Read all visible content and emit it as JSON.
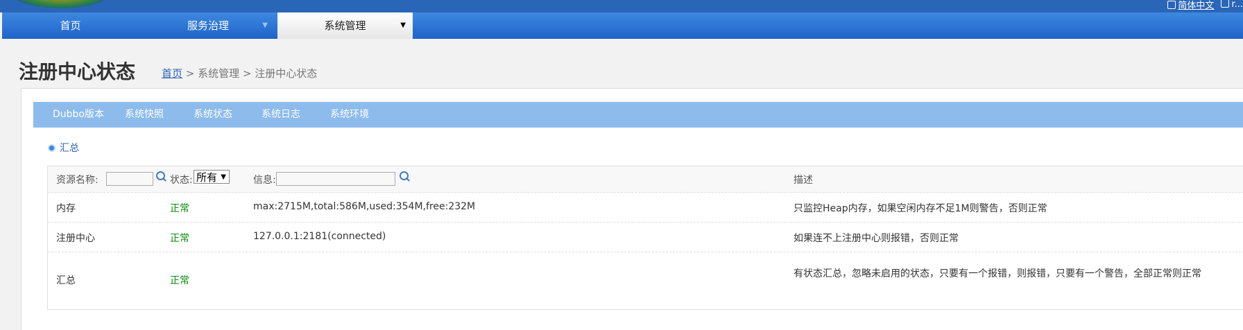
{
  "header": {
    "language_link": "简体中文",
    "user_label": "r..."
  },
  "nav": {
    "home": "首页",
    "service_governance": "服务治理",
    "system_management": "系统管理",
    "dropdown_arrow": "▼"
  },
  "page": {
    "title": "注册中心状态",
    "breadcrumb_home": "首页",
    "breadcrumb_sep1": " > ",
    "breadcrumb_system": "系统管理",
    "breadcrumb_sep2": " > ",
    "breadcrumb_current": "注册中心状态"
  },
  "subtabs": [
    "Dubbo版本",
    "系统快照",
    "系统状态",
    "系统日志",
    "系统环境"
  ],
  "summary_link": "汇总",
  "table": {
    "headers": {
      "name_label": "资源名称:",
      "status_label": "状态:",
      "status_selected": "所有",
      "info_label": "信息:",
      "desc_label": "描述"
    },
    "rows": [
      {
        "name": "内存",
        "status": "正常",
        "info": "max:2715M,total:586M,used:354M,free:232M",
        "desc": "只监控Heap内存，如果空闲内存不足1M则警告，否则正常"
      },
      {
        "name": "注册中心",
        "status": "正常",
        "info": "127.0.0.1:2181(connected)",
        "desc": "如果连不上注册中心则报错，否则正常"
      },
      {
        "name": "汇总",
        "status": "正常",
        "info": "",
        "desc": "有状态汇总，忽略未启用的状态，只要有一个报错，则报错，只要有一个警告，全部正常则正常"
      }
    ]
  },
  "colors": {
    "nav_blue": "#1f63c9",
    "subtab_blue": "#8cbbec",
    "status_ok": "#0a8a0a",
    "link_blue": "#2a63b5"
  }
}
